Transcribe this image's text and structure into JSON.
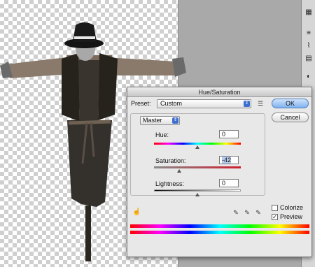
{
  "dialog": {
    "title": "Hue/Saturation",
    "preset_label": "Preset:",
    "preset_value": "Custom",
    "preset_options_icon": "list-options-icon",
    "ok_label": "OK",
    "cancel_label": "Cancel",
    "channel_value": "Master",
    "hue": {
      "label": "Hue:",
      "value": "0",
      "level": 0.5
    },
    "saturation": {
      "label": "Saturation:",
      "value": "-42",
      "level": 0.29
    },
    "lightness": {
      "label": "Lightness:",
      "value": "0",
      "level": 0.5
    },
    "colorize_label": "Colorize",
    "colorize_checked": false,
    "preview_label": "Preview",
    "preview_checked": true,
    "icons": [
      "hand-target-icon",
      "eyedropper-icon",
      "eyedropper-plus-icon",
      "eyedropper-minus-icon"
    ]
  },
  "tools_panel": {
    "icons": [
      "grid-icon",
      "sliders-icon",
      "path-icon",
      "adjust-icon",
      "mask-icon"
    ]
  },
  "colors": {
    "checker": "#cfcfcf",
    "ok_button": "#7fb1ef",
    "saturation_track_end": "#cc2030"
  }
}
